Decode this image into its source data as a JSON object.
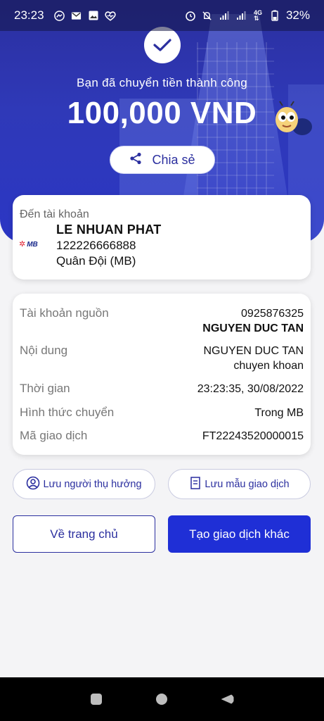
{
  "status_bar": {
    "time": "23:23",
    "battery": "32%",
    "left_icons": [
      "messenger-icon",
      "gmail-icon",
      "gallery-icon",
      "health-icon"
    ],
    "right_icons": [
      "alarm-icon",
      "mute-icon",
      "signal-icon",
      "signal-icon",
      "4g-icon",
      "battery-icon"
    ]
  },
  "hero": {
    "success_message": "Bạn đã chuyển tiền thành công",
    "amount": "100,000 VND",
    "share_label": "Chia sẻ",
    "colors": {
      "primary": "#2b2f9f",
      "accent": "#1f2fd6"
    }
  },
  "destination": {
    "label": "Đến tài khoản",
    "bank_logo_text": "MB",
    "name": "LE NHUAN PHAT",
    "account": "122226666888",
    "bank": "Quân Đội (MB)"
  },
  "details": {
    "source_label": "Tài khoản nguồn",
    "source_account": "0925876325",
    "source_name": "NGUYEN DUC TAN",
    "content_label": "Nội dung",
    "content_line1": "NGUYEN DUC TAN",
    "content_line2": "chuyen khoan",
    "time_label": "Thời gian",
    "time_value": "23:23:35, 30/08/2022",
    "method_label": "Hình thức chuyển",
    "method_value": "Trong MB",
    "code_label": "Mã giao dịch",
    "code_value": "FT22243520000015"
  },
  "actions": {
    "save_beneficiary": "Lưu người thụ hưởng",
    "save_template": "Lưu mẫu giao dịch",
    "home": "Về trang chủ",
    "new_transaction": "Tạo giao dịch khác"
  }
}
